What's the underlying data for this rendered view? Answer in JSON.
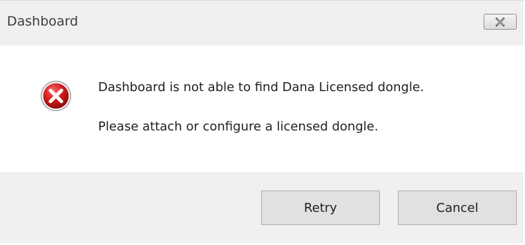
{
  "window": {
    "title": "Dashboard"
  },
  "message": {
    "line1": "Dashboard is not able to find Dana Licensed dongle.",
    "line2": "Please attach or configure a licensed dongle.",
    "icon": "error-icon"
  },
  "buttons": {
    "retry_label": "Retry",
    "cancel_label": "Cancel"
  },
  "colors": {
    "error_red": "#c8102e",
    "titlebar": "#f0f0f0",
    "footer": "#f0f0f0"
  }
}
